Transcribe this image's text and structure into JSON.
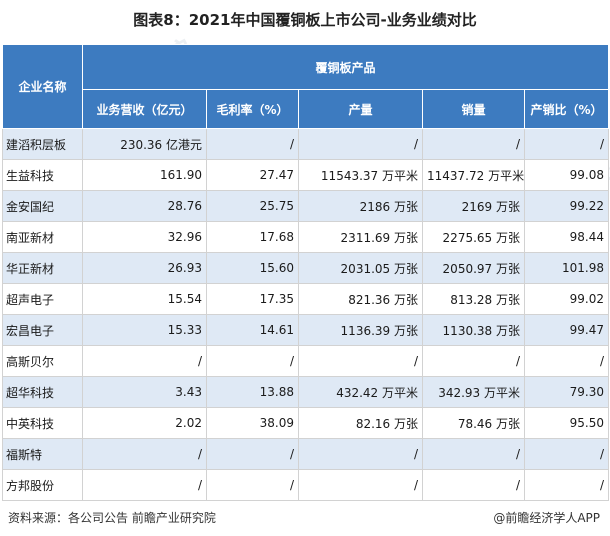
{
  "title": "图表8：2021年中国覆铜板上市公司-业务业绩对比",
  "header": {
    "company": "企业名称",
    "group": "覆铜板产品",
    "columns": [
      "业务营收（亿元）",
      "毛利率（%）",
      "产量",
      "销量",
      "产销比（%）"
    ]
  },
  "rows": [
    {
      "name": "建滔积层板",
      "revenue": "230.36 亿港元",
      "margin": "/",
      "output": "/",
      "sales": "/",
      "ratio": "/"
    },
    {
      "name": "生益科技",
      "revenue": "161.90",
      "margin": "27.47",
      "output": "11543.37 万平米",
      "sales": "11437.72 万平米",
      "ratio": "99.08"
    },
    {
      "name": "金安国纪",
      "revenue": "28.76",
      "margin": "25.75",
      "output": "2186 万张",
      "sales": "2169 万张",
      "ratio": "99.22"
    },
    {
      "name": "南亚新材",
      "revenue": "32.96",
      "margin": "17.68",
      "output": "2311.69 万张",
      "sales": "2275.65 万张",
      "ratio": "98.44"
    },
    {
      "name": "华正新材",
      "revenue": "26.93",
      "margin": "15.60",
      "output": "2031.05 万张",
      "sales": "2050.97 万张",
      "ratio": "101.98"
    },
    {
      "name": "超声电子",
      "revenue": "15.54",
      "margin": "17.35",
      "output": "821.36 万张",
      "sales": "813.28 万张",
      "ratio": "99.02"
    },
    {
      "name": "宏昌电子",
      "revenue": "15.33",
      "margin": "14.61",
      "output": "1136.39 万张",
      "sales": "1130.38 万张",
      "ratio": "99.47"
    },
    {
      "name": "高斯贝尔",
      "revenue": "/",
      "margin": "/",
      "output": "/",
      "sales": "/",
      "ratio": "/"
    },
    {
      "name": "超华科技",
      "revenue": "3.43",
      "margin": "13.88",
      "output": "432.42 万平米",
      "sales": "342.93 万平米",
      "ratio": "79.30"
    },
    {
      "name": "中英科技",
      "revenue": "2.02",
      "margin": "38.09",
      "output": "82.16 万张",
      "sales": "78.46 万张",
      "ratio": "95.50"
    },
    {
      "name": "福斯特",
      "revenue": "/",
      "margin": "/",
      "output": "/",
      "sales": "/",
      "ratio": "/"
    },
    {
      "name": "方邦股份",
      "revenue": "/",
      "margin": "/",
      "output": "/",
      "sales": "/",
      "ratio": "/"
    }
  ],
  "footer": {
    "source": "资料来源：各公司公告 前瞻产业研究院",
    "brand": "@前瞻经济学人APP"
  },
  "watermark": "前瞻产业研究院"
}
